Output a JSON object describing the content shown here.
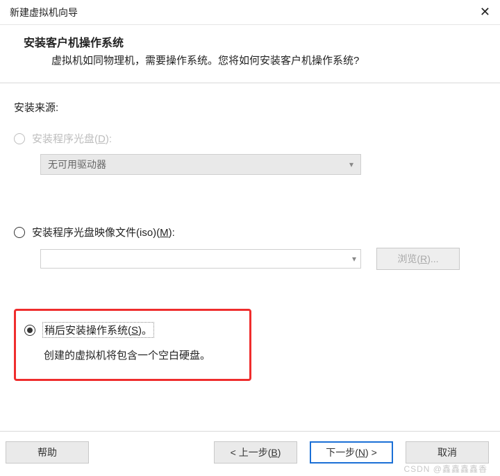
{
  "window": {
    "title": "新建虚拟机向导",
    "close": "✕"
  },
  "header": {
    "heading": "安装客户机操作系统",
    "subheading": "虚拟机如同物理机，需要操作系统。您将如何安装客户机操作系统?"
  },
  "source_label": "安装来源:",
  "opt_disc": {
    "label_pre": "安装程序光盘(",
    "hotkey": "D",
    "label_post": "):",
    "dropdown_value": "无可用驱动器",
    "enabled": false
  },
  "opt_iso": {
    "label_pre": "安装程序光盘映像文件(iso)(",
    "hotkey": "M",
    "label_post": "):",
    "browse_pre": "浏览(",
    "browse_hotkey": "R",
    "browse_post": ")...",
    "value": ""
  },
  "opt_later": {
    "label_pre": "稍后安装操作系统(",
    "hotkey": "S",
    "label_post": ")。",
    "desc": "创建的虚拟机将包含一个空白硬盘。",
    "selected": true
  },
  "buttons": {
    "help": "帮助",
    "back_pre": "< 上一步(",
    "back_hotkey": "B",
    "back_post": ")",
    "next_pre": "下一步(",
    "next_hotkey": "N",
    "next_post": ") >",
    "cancel": "取消"
  },
  "watermark": "CSDN @鑫鑫鑫鑫香"
}
